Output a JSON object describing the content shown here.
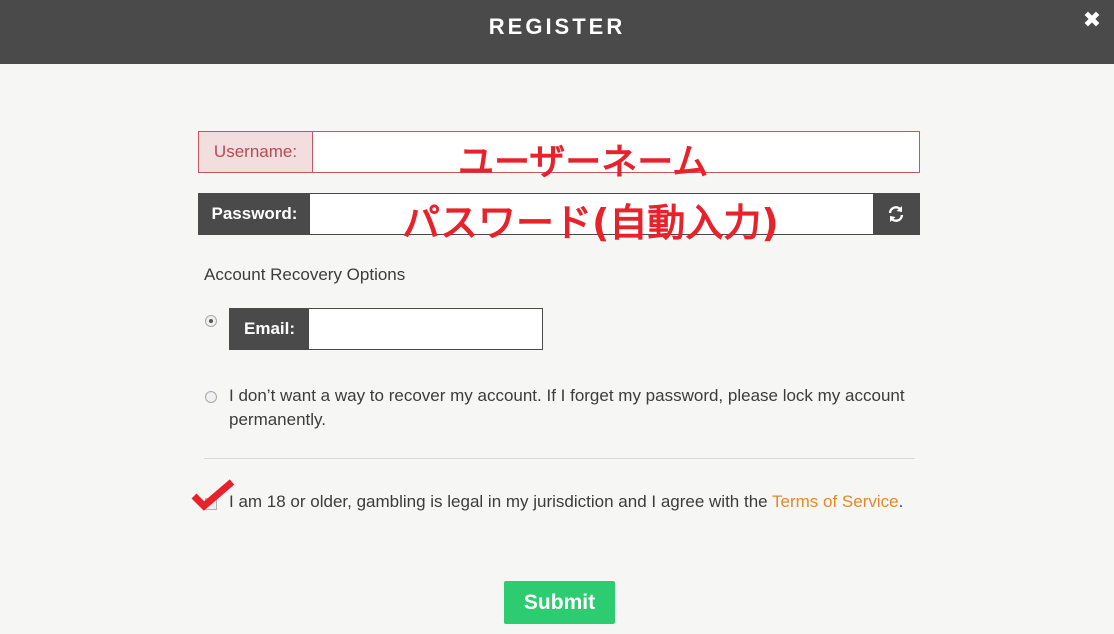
{
  "header": {
    "title": "REGISTER",
    "close_glyph": "✖"
  },
  "username": {
    "label": "Username:",
    "value": "",
    "overlay": "ユーザーネーム"
  },
  "password": {
    "label": "Password:",
    "value": "",
    "overlay": "パスワード(自動入力)",
    "refresh_icon": "refresh-icon"
  },
  "recovery": {
    "title": "Account Recovery Options",
    "email_label": "Email:",
    "email_value": "",
    "email_selected": true,
    "no_recovery_text": "I don’t want a way to recover my account. If I forget my password, please lock my account permanently."
  },
  "terms": {
    "text": "I am 18 or older, gambling is legal in my jurisdiction and I agree with the ",
    "link": "Terms of Service",
    "after": ".",
    "annotation_color": "#e8222a"
  },
  "submit": {
    "label": "Submit",
    "color": "#2ecc71"
  },
  "colors": {
    "header_bg": "#4a4a4a",
    "error_border": "#c9555f",
    "link": "#e4882a"
  }
}
